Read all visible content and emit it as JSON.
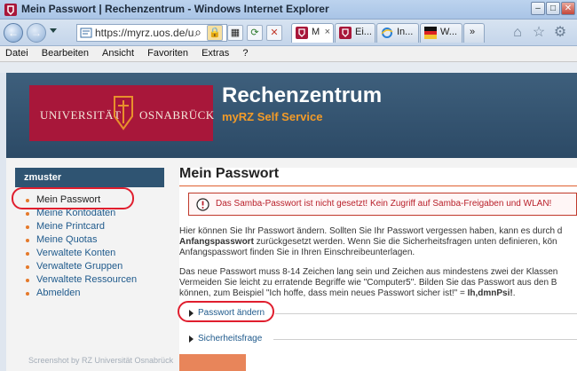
{
  "window": {
    "title": "Mein Passwort | Rechenzentrum - Windows Internet Explorer",
    "minimize": "0",
    "maximize": "1",
    "close": "r"
  },
  "nav": {
    "back": "←",
    "forward": "→",
    "address": "https://myrz.uos.de/u",
    "search": "⌕",
    "stop": "✕",
    "refresh": "⟳"
  },
  "tabs": [
    {
      "label": "M"
    },
    {
      "label": "Ei..."
    },
    {
      "label": "In..."
    },
    {
      "label": "W..."
    }
  ],
  "tab_more": "»",
  "right_icons": {
    "home": "⌂",
    "favorites": "☆",
    "tools": "⚙"
  },
  "menu": [
    "Datei",
    "Bearbeiten",
    "Ansicht",
    "Favoriten",
    "Extras",
    "?"
  ],
  "banner": {
    "logo_left": "UNIVERSITÄT",
    "logo_right": "OSNABRÜCK",
    "title": "Rechenzentrum",
    "subtitle": "myRZ Self Service"
  },
  "sidebar": {
    "user": "zmuster",
    "items": [
      {
        "label": "Mein Passwort"
      },
      {
        "label": "Meine Kontodaten"
      },
      {
        "label": "Meine Printcard"
      },
      {
        "label": "Meine Quotas"
      },
      {
        "label": "Verwaltete Konten"
      },
      {
        "label": "Verwaltete Gruppen"
      },
      {
        "label": "Verwaltete Ressourcen"
      },
      {
        "label": "Abmelden"
      }
    ]
  },
  "content": {
    "heading": "Mein Passwort",
    "alert": "Das Samba-Passwort ist nicht gesetzt! Kein Zugriff auf Samba-Freigaben und WLAN!",
    "para1_line1": "Hier können Sie Ihr Passwort ändern. Sollten Sie Ihr Passwort vergessen haben, kann es durch d",
    "para1_line2_bold": "Anfangspasswort",
    "para1_line2_rest": " zurückgesetzt werden. Wenn Sie die Sicherheitsfragen unten definieren, kön",
    "para1_line3": "Anfangspasswort finden Sie in Ihren Einschreibeunterlagen.",
    "para2_line1": "Das neue Passwort muss 8-14 Zeichen lang sein und Zeichen aus mindestens zwei der Klassen",
    "para2_line2": "Vermeiden Sie leicht zu erratende Begriffe wie \"Computer5\". Bilden Sie das Passwort aus den B",
    "para2_line3_pre": "können, zum Beispiel \"Ich hoffe, dass mein neues Passwort sicher ist!\" = ",
    "para2_line3_bold": "Ih,dmnPsi!",
    "para2_line3_post": ".",
    "accordion1": "Passwort ändern",
    "accordion2": "Sicherheitsfrage"
  },
  "footer": "Screenshot by RZ Universität Osnabrück",
  "colors": {
    "banner": "#2c4a66",
    "logo": "#a8173a",
    "accent": "#f29b28",
    "link": "#1f5a8c",
    "alert": "#b8202a",
    "highlight": "#e01e2e"
  }
}
